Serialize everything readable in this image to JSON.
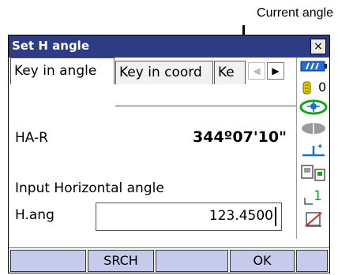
{
  "callout": {
    "text": "Current angle"
  },
  "window": {
    "title": "Set H angle",
    "close_symbol": "×"
  },
  "tabs": [
    {
      "label": "Key in angle"
    },
    {
      "label": "Key in coord"
    },
    {
      "label": "Ke"
    }
  ],
  "tab_scroll": {
    "left_symbol": "◀",
    "right_symbol": "▶"
  },
  "main": {
    "ha_label": "HA-R",
    "ha_value": "344º07'10\"",
    "input_caption": "Input Horizontal angle",
    "hang_label": "H.ang",
    "hang_value": "123.4500"
  },
  "sidebar": {
    "battery_icon": "battery-icon",
    "prism_constant": "0",
    "mode_icon": "target-icon",
    "tilt_icon": "ellipse-icon",
    "ppm_icon": "level-icon",
    "comm_icon": "communication-icon",
    "signal_value": "1",
    "memory_icon": "memory-card-icon"
  },
  "softkeys": [
    {
      "label": ""
    },
    {
      "label": "SRCH"
    },
    {
      "label": ""
    },
    {
      "label": "OK"
    },
    {
      "label": ""
    }
  ],
  "colors": {
    "titlebar": "#2d3c85",
    "softkey": "#c7cbeb",
    "accent_green": "#12a31f",
    "accent_blue": "#1f6fd1"
  }
}
